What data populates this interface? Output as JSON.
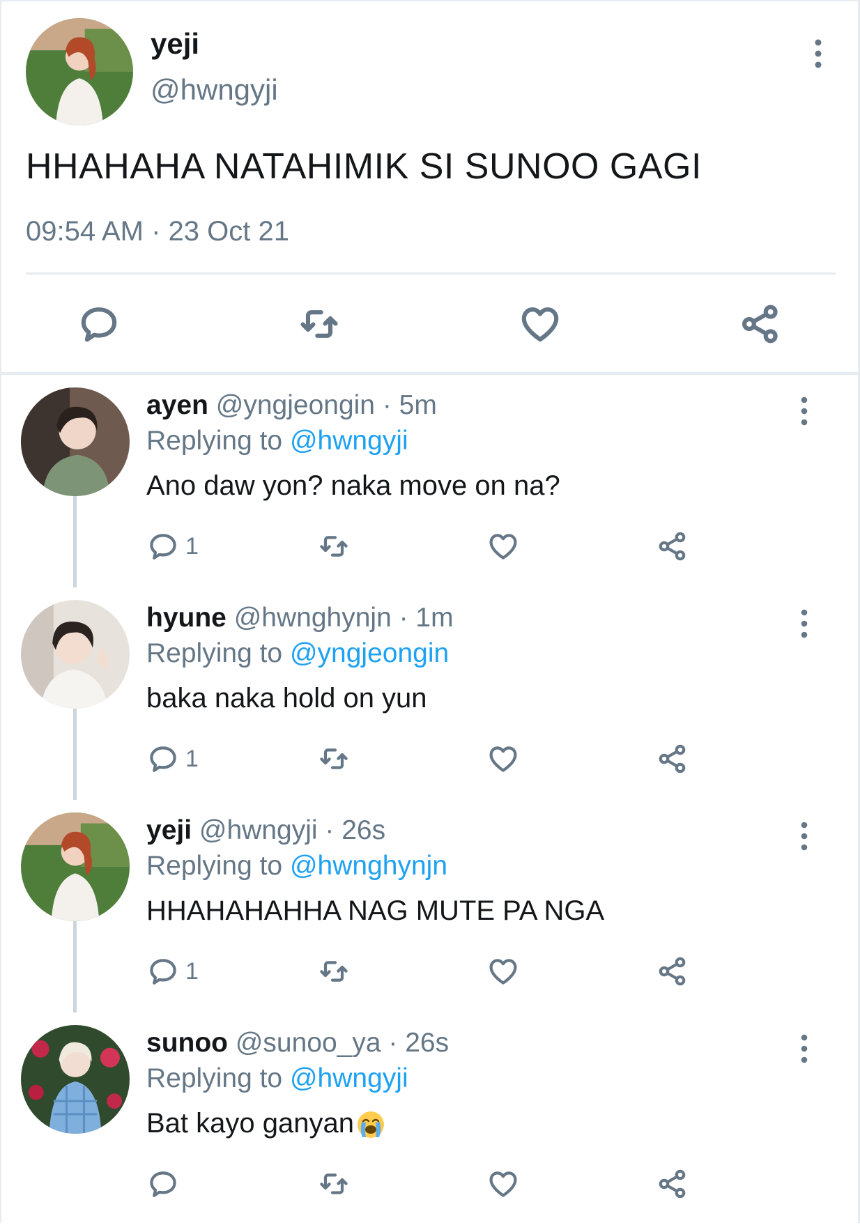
{
  "main_tweet": {
    "name": "yeji",
    "handle": "@hwngyji",
    "text": "HHAHAHA NATAHIMIK SI SUNOO GAGI",
    "timestamp": "09:54 AM · 23 Oct 21",
    "icons": [
      "reply-icon",
      "retweet-icon",
      "like-icon",
      "share-icon",
      "more-icon"
    ]
  },
  "replies": [
    {
      "name": "ayen",
      "handle_time": " @yngjeongin · 5m",
      "replying_prefix": "Replying to ",
      "replying_to": "@hwngyji",
      "text": "Ano daw yon? naka move on na?",
      "reply_count": "1"
    },
    {
      "name": "hyune",
      "handle_time": " @hwnghynjn · 1m",
      "replying_prefix": "Replying to ",
      "replying_to": "@yngjeongin",
      "text": "baka naka hold on yun",
      "reply_count": "1"
    },
    {
      "name": "yeji",
      "handle_time": " @hwngyji · 26s",
      "replying_prefix": "Replying to ",
      "replying_to": "@hwnghynjn",
      "text": "HHAHAHAHHA NAG MUTE PA NGA",
      "reply_count": "1"
    },
    {
      "name": "sunoo",
      "handle_time": " @sunoo_ya · 26s",
      "replying_prefix": "Replying to ",
      "replying_to": "@hwngyji",
      "text": "Bat kayo ganyan",
      "reply_count": "",
      "emoji": "loudly-crying-face"
    }
  ],
  "colors": {
    "text": "#14171a",
    "secondary": "#657786",
    "mention": "#1da1f2",
    "divider": "#e6ecf0"
  }
}
